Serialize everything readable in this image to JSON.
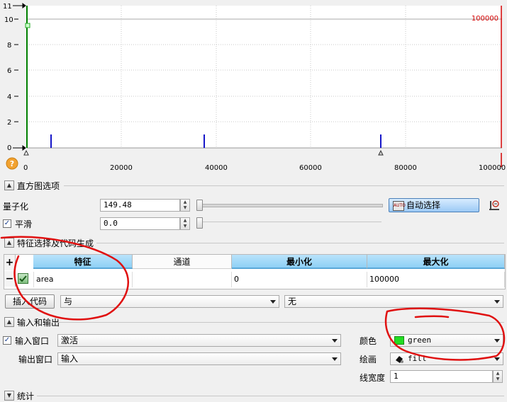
{
  "histogram": {
    "y_ticks": [
      "11",
      "10",
      "8",
      "6",
      "4",
      "2",
      "0"
    ],
    "x_ticks": [
      "0",
      "20000",
      "40000",
      "60000",
      "80000",
      "100000"
    ],
    "max_label": "100000",
    "help_icon_glyph": "?",
    "colors": {
      "max_line": "#d40000",
      "bars": "#1616c8",
      "min_line": "#008000",
      "grid": "#c8c8c8"
    }
  },
  "histogram_options": {
    "title": "直方图选项",
    "quantize_label": "量子化",
    "quantize_value": "149.48",
    "smooth_label": "平滑",
    "smooth_checked": true,
    "smooth_value": "0.0",
    "auto_select_label": "自动选择"
  },
  "feature_selection": {
    "title": "特征选择及代码生成",
    "add_glyph": "+",
    "remove_glyph": "−",
    "headers": [
      "特征",
      "通道",
      "最小化",
      "最大化"
    ],
    "rows": [
      {
        "feature": "area",
        "channel": "",
        "min": "0",
        "max": "100000"
      }
    ],
    "insert_code_label": "插入代码",
    "operator_value": "与",
    "condition_value": "无"
  },
  "io": {
    "title": "输入和输出",
    "input_window_label": "输入窗口",
    "input_window_checked": true,
    "input_window_value": "激活",
    "output_window_label": "输出窗口",
    "output_window_value": "输入",
    "color_label": "颜色",
    "color_value": "green",
    "color_swatch": "#22dd22",
    "draw_label": "绘画",
    "draw_value": "fill",
    "line_width_label": "线宽度",
    "line_width_value": "1"
  },
  "statistics": {
    "title": "统计"
  },
  "annotation_color": "#e01010"
}
